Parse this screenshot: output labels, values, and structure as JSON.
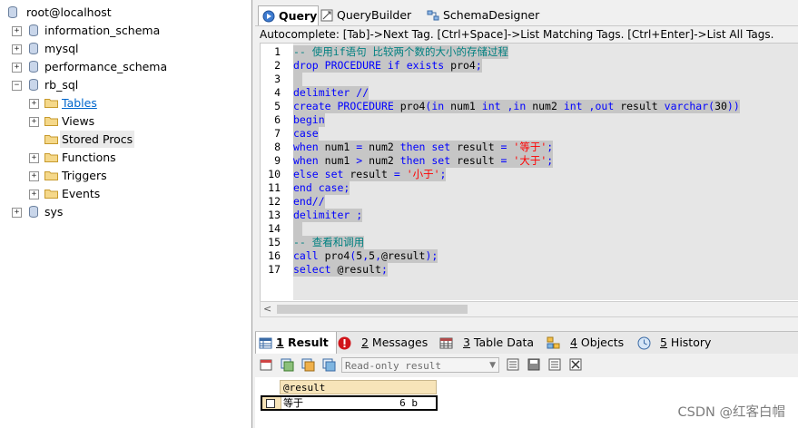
{
  "tree": {
    "root": "root@localhost",
    "databases": [
      "information_schema",
      "mysql",
      "performance_schema",
      "rb_sql"
    ],
    "rb_sql_children": [
      "Tables",
      "Views",
      "Stored Procs",
      "Functions",
      "Triggers",
      "Events"
    ],
    "last_db": "sys",
    "expand_plus": "+",
    "expand_minus": "−"
  },
  "tabs": [
    "Query",
    "QueryBuilder",
    "SchemaDesigner"
  ],
  "autocomplete": "Autocomplete: [Tab]->Next Tag. [Ctrl+Space]->List Matching Tags. [Ctrl+Enter]->List All Tags.",
  "editor": {
    "line_numbers": [
      "1",
      "2",
      "3",
      "4",
      "5",
      "6",
      "7",
      "8",
      "9",
      "10",
      "11",
      "12",
      "13",
      "14",
      "15",
      "16",
      "17"
    ],
    "lines": [
      "-- 使用if语句 比较两个数的大小的存储过程",
      "drop PROCEDURE if exists pro4;",
      "",
      "delimiter //",
      "create PROCEDURE pro4(in num1 int ,in num2 int ,out result varchar(30))",
      "begin",
      "case",
      "when num1 = num2 then set result = '等于';",
      "when num1 > num2 then set result = '大于';",
      "else set result = '小于';",
      "end case;",
      "end//",
      "delimiter ;",
      "",
      "-- 查看和调用",
      "call pro4(5,5,@result);",
      "select @result;"
    ],
    "scroll_left_arrow": "<"
  },
  "result_tabs": {
    "numbers": [
      "1",
      "2",
      "3",
      "4",
      "5"
    ],
    "labels": [
      " Result",
      " Messages",
      " Table Data",
      " Objects",
      " History"
    ]
  },
  "result_toolbar": {
    "mode": "Read-only result",
    "dropdown_arrow": "▼"
  },
  "grid": {
    "header": "@result",
    "cell_value": "等于",
    "cell_size": "6 b"
  },
  "watermark": "CSDN @红客白帽",
  "colors": {
    "keyword": "#0000ff",
    "comment": "#008080",
    "string": "#ff0000",
    "selection": "#c6c6c6",
    "grid_header": "#f7e4b9"
  },
  "icons": {
    "db": "database-icon",
    "folder": "folder-icon",
    "query": "query-icon",
    "builder": "query-builder-icon",
    "designer": "schema-designer-icon"
  }
}
